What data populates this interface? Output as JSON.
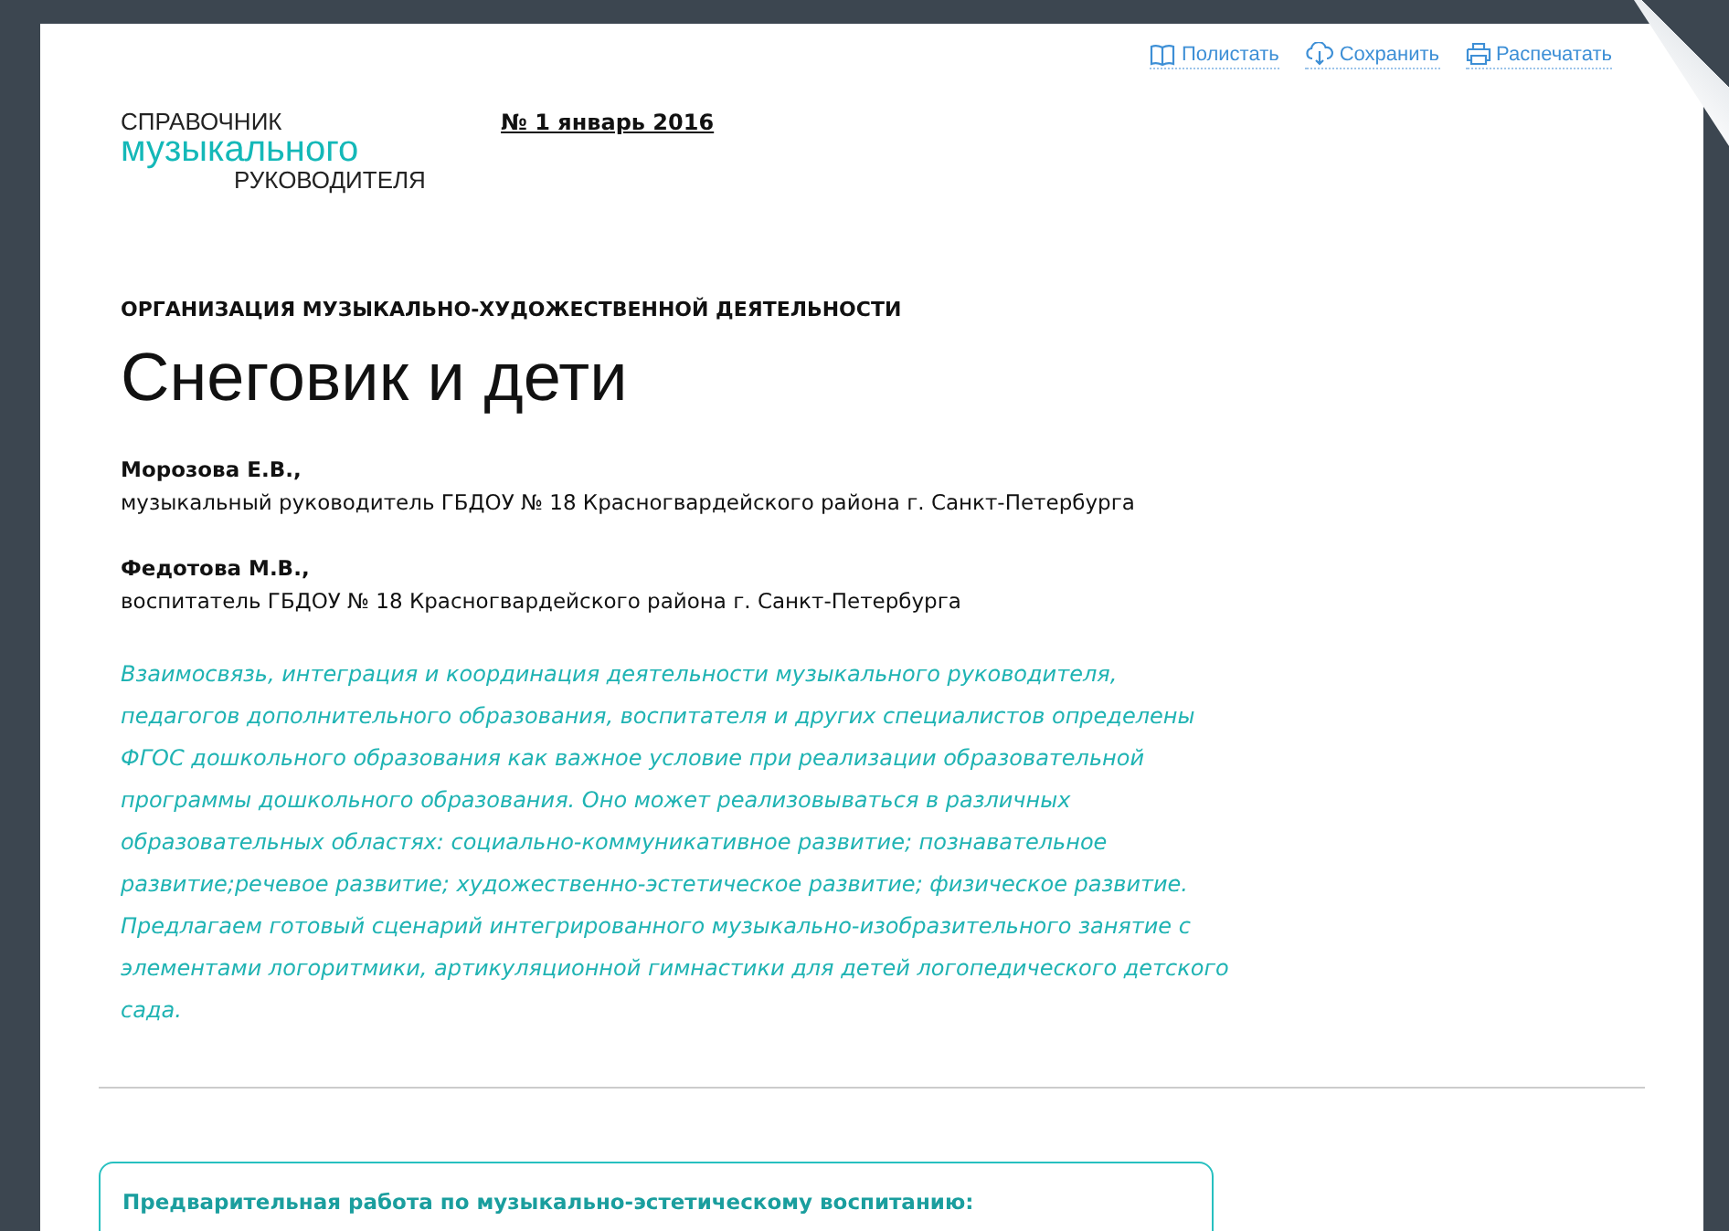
{
  "toolbar": [
    {
      "kind": "book",
      "label": "Полистать"
    },
    {
      "kind": "cloud",
      "label": "Сохранить"
    },
    {
      "kind": "print",
      "label": "Распечатать"
    }
  ],
  "logo": {
    "line_1": "СПРАВОЧНИК",
    "line_2": "музыкального",
    "line_3": "РУКОВОДИТЕЛЯ"
  },
  "issue": "№ 1 январь 2016",
  "rubric": "ОРГАНИЗАЦИЯ МУЗЫКАЛЬНО-ХУДОЖЕСТВЕННОЙ ДЕЯТЕЛЬНОСТИ",
  "title": "Снеговик и дети",
  "authors": [
    {
      "name": "Морозова Е.В.,",
      "position": "музыкальный руководитель ГБДОУ № 18 Красногвардейского района г. Санкт-Петербурга"
    },
    {
      "name": "Федотова М.В.,",
      "position": "воспитатель ГБДОУ № 18 Красногвардейского района г. Санкт-Петербурга"
    }
  ],
  "lead": "Взаимосвязь, интеграция и координация  деятельности  музыкального руководителя, педагогов дополнительного образования, воспитателя и других специалистов определены ФГОС дошкольного образования как важное условие при реализации образовательной программы дошкольного образования. Оно может реализовываться в различных  образовательных областях: социально-коммуникативное развитие; познавательное развитие;речевое развитие; художественно-эстетическое развитие; физическое развитие.   Предлагаем готовый сценарий интегрированного музыкально-изобразительного занятие с элементами логоритмики, артикуляционной гимнастики для детей логопедического детского сада.",
  "box": {
    "heading": "Предварительная работа по музыкально-эстетическому воспитанию:"
  }
}
